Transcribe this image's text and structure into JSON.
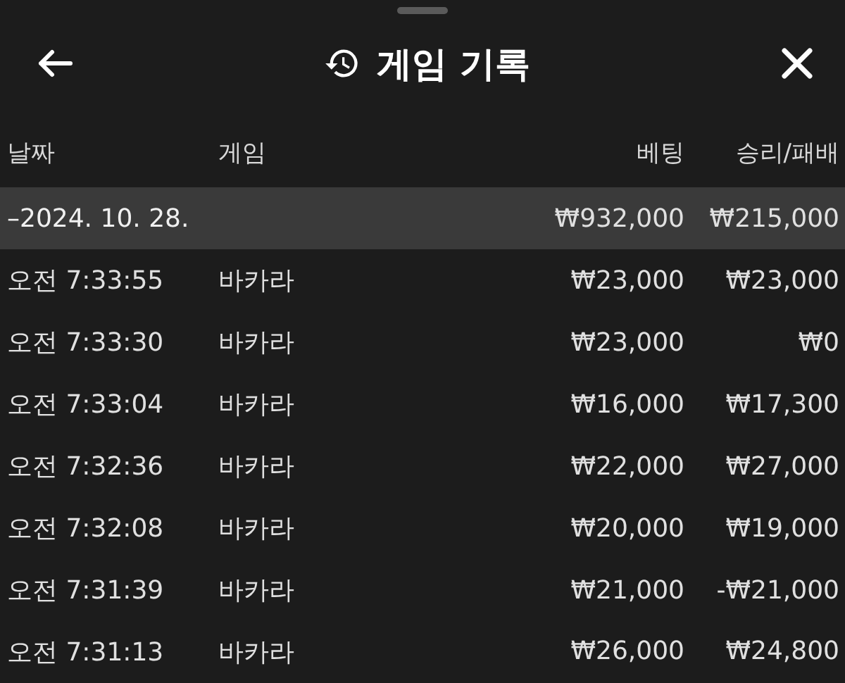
{
  "header": {
    "title": "게임 기록"
  },
  "table": {
    "columns": [
      "날짜",
      "게임",
      "베팅",
      "승리/패배"
    ],
    "group": {
      "label": "–2024. 10. 28.",
      "bet": "₩932,000",
      "result": "₩215,000"
    },
    "rows": [
      {
        "time": "오전 7:33:55",
        "game": "바카라",
        "bet": "₩23,000",
        "result": "₩23,000"
      },
      {
        "time": "오전 7:33:30",
        "game": "바카라",
        "bet": "₩23,000",
        "result": "₩0"
      },
      {
        "time": "오전 7:33:04",
        "game": "바카라",
        "bet": "₩16,000",
        "result": "₩17,300"
      },
      {
        "time": "오전 7:32:36",
        "game": "바카라",
        "bet": "₩22,000",
        "result": "₩27,000"
      },
      {
        "time": "오전 7:32:08",
        "game": "바카라",
        "bet": "₩20,000",
        "result": "₩19,000"
      },
      {
        "time": "오전 7:31:39",
        "game": "바카라",
        "bet": "₩21,000",
        "result": "-₩21,000"
      },
      {
        "time": "오전 7:31:13",
        "game": "바카라",
        "bet": "₩26,000",
        "result": "₩24,800"
      }
    ]
  }
}
